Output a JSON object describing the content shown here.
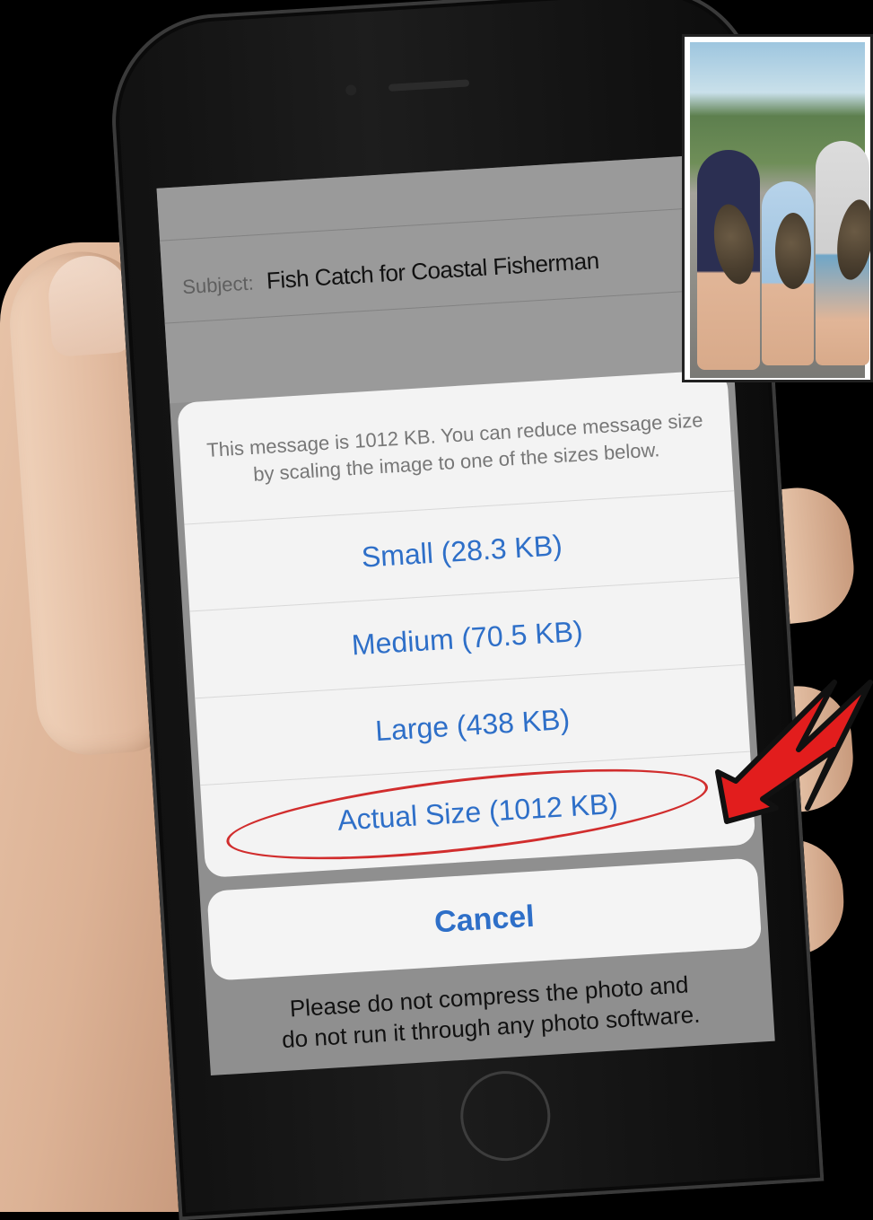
{
  "email": {
    "subject_label": "Subject:",
    "subject_value": "Fish Catch for Coastal Fisherman"
  },
  "action_sheet": {
    "message": "This message is 1012 KB. You can reduce message size by scaling the image to one of the sizes below.",
    "options": [
      {
        "label": "Small (28.3 KB)"
      },
      {
        "label": "Medium (70.5 KB)"
      },
      {
        "label": "Large (438 KB)"
      },
      {
        "label": "Actual Size (1012 KB)",
        "highlighted": true
      }
    ],
    "cancel_label": "Cancel"
  },
  "note": {
    "line1": "Please do not compress the photo and",
    "line2": "do not run it through any photo software."
  },
  "colors": {
    "accent_blue": "#2e6fc8",
    "highlight_red": "#d12d2d",
    "arrow_red": "#e21d1d"
  }
}
